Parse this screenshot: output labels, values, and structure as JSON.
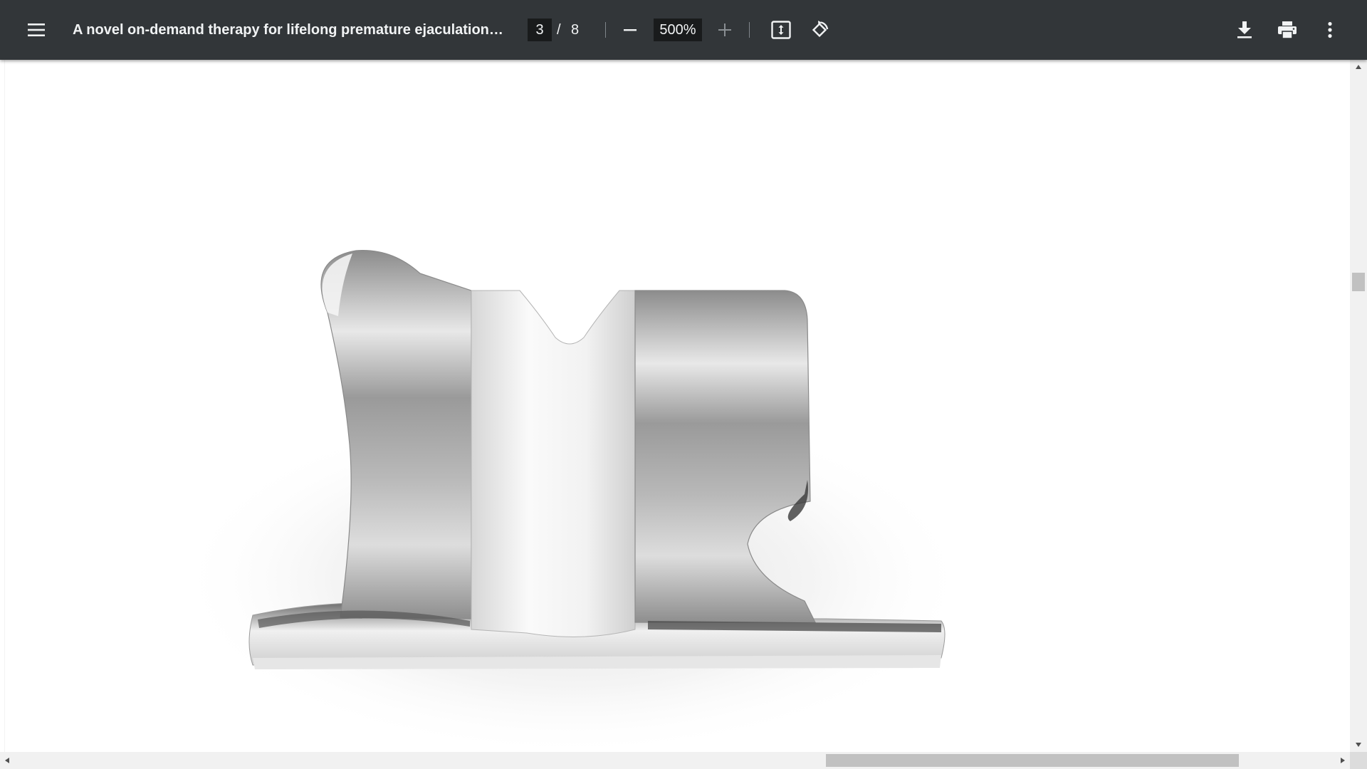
{
  "toolbar": {
    "menu_icon": "hamburger-menu-icon",
    "title": "A novel on-demand therapy for lifelong premature ejaculation u...",
    "current_page": "3",
    "page_separator": "/",
    "total_pages": "8",
    "zoom_out_icon": "minus-icon",
    "zoom_level": "500%",
    "zoom_in_icon": "plus-icon",
    "fit_icon": "fit-to-page-icon",
    "rotate_icon": "rotate-counterclockwise-icon",
    "download_icon": "download-icon",
    "print_icon": "print-icon",
    "more_icon": "more-vert-icon",
    "colors": {
      "background": "#323639",
      "text": "#f1f3f4",
      "input_background": "#191b1c"
    }
  },
  "document": {
    "figure_description_icon": "silver-orthodontic-bracket-figure"
  },
  "scrollbars": {
    "vertical_position_fraction": 0.31,
    "horizontal_position_fraction": 0.6
  }
}
